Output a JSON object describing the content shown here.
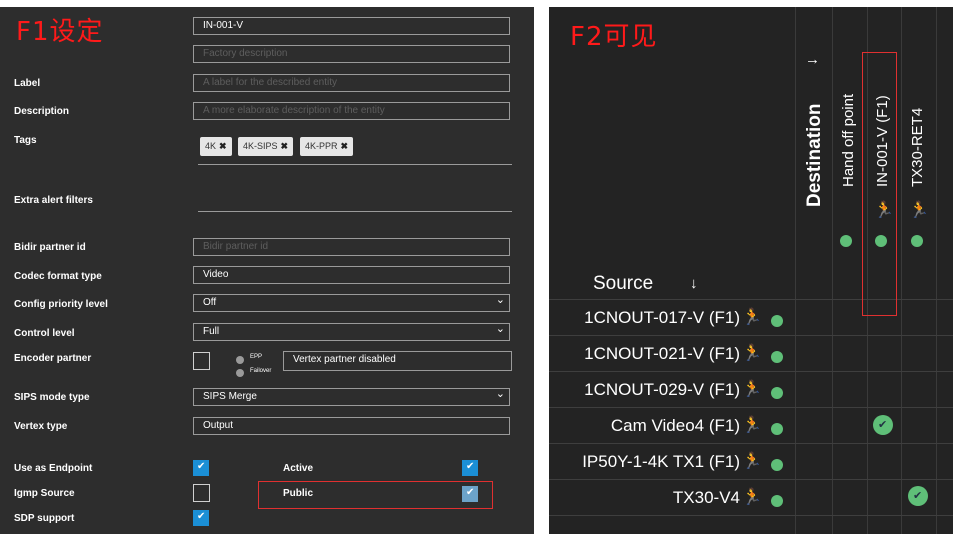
{
  "left_panel": {
    "title": "F1设定",
    "name_value": "IN-001-V",
    "factory_description_placeholder": "Factory description",
    "label_label": "Label",
    "label_placeholder": "A label for the described entity",
    "description_label": "Description",
    "description_placeholder": "A more elaborate description of the entity",
    "tags_label": "Tags",
    "tags": [
      "4K",
      "4K-SIPS",
      "4K-PPR"
    ],
    "extra_alert_filters_label": "Extra alert filters",
    "bidir_partner_id_label": "Bidir partner id",
    "bidir_partner_id_placeholder": "Bidir partner id",
    "codec_format_type_label": "Codec format type",
    "codec_format_type_value": "Video",
    "config_priority_level_label": "Config priority level",
    "config_priority_level_value": "Off",
    "control_level_label": "Control level",
    "control_level_value": "Full",
    "encoder_partner_label": "Encoder partner",
    "encoder_partner_radio_epp": "EPP",
    "encoder_partner_radio_failover": "Failover",
    "encoder_partner_value": "Vertex partner disabled",
    "sips_mode_type_label": "SIPS mode type",
    "sips_mode_type_value": "SIPS Merge",
    "vertex_type_label": "Vertex type",
    "vertex_type_value": "Output",
    "use_as_endpoint_label": "Use as Endpoint",
    "use_as_endpoint_checked": true,
    "active_label": "Active",
    "active_checked": true,
    "igmp_source_label": "Igmp Source",
    "igmp_source_checked": false,
    "public_label": "Public",
    "public_checked": true,
    "sdp_support_label": "SDP support",
    "sdp_support_checked": true,
    "highlight_color": "#e03030"
  },
  "right_panel": {
    "title": "F2可见",
    "destination_label": "Destination",
    "source_label": "Source",
    "destinations": [
      "Hand off point",
      "IN-001-V (F1)",
      "TX30-RET4"
    ],
    "sources": [
      "1CNOUT-017-V (F1)",
      "1CNOUT-021-V (F1)",
      "1CNOUT-029-V (F1)",
      "Cam Video4 (F1)",
      "IP50Y-1-4K TX1 (F1)",
      "TX30-V4"
    ],
    "connections": [
      {
        "source": "Cam Video4 (F1)",
        "destination": "IN-001-V (F1)"
      },
      {
        "source": "TX30-V4",
        "destination": "TX30-RET4"
      }
    ],
    "status_color": "#5fbf78",
    "icons": {
      "runner": "person-running-icon",
      "arrow_right": "arrow-right-icon",
      "arrow_down": "arrow-down-icon",
      "check": "check-circle-icon"
    }
  }
}
